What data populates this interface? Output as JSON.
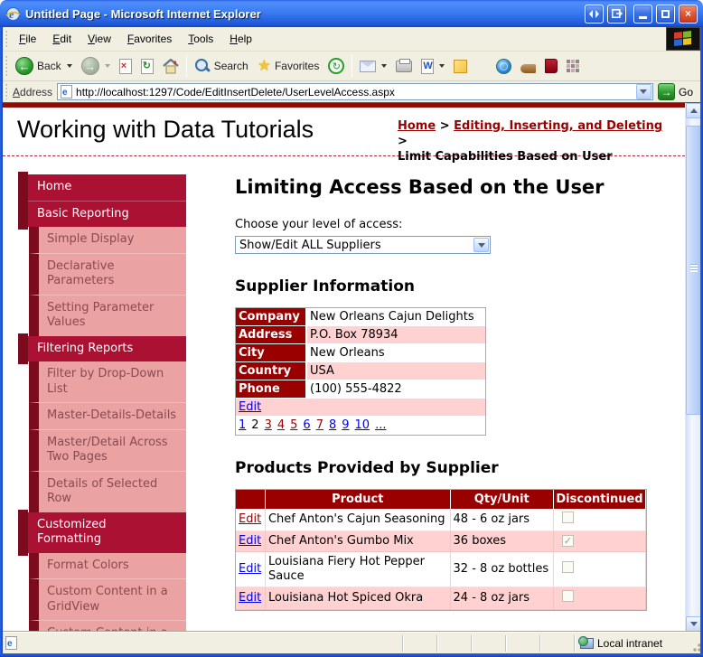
{
  "window": {
    "title": "Untitled Page - Microsoft Internet Explorer",
    "menu": [
      "File",
      "Edit",
      "View",
      "Favorites",
      "Tools",
      "Help"
    ],
    "toolbar": {
      "back_label": "Back",
      "search_label": "Search",
      "favorites_label": "Favorites"
    },
    "address": {
      "label": "Address",
      "value": "http://localhost:1297/Code/EditInsertDelete/UserLevelAccess.aspx",
      "go_label": "Go"
    },
    "status": {
      "zone_label": "Local intranet"
    }
  },
  "icons": {
    "close_glyph": "×",
    "back_glyph": "←",
    "forward_glyph": "→",
    "stop_glyph": "×",
    "refresh_glyph": "↻",
    "history_glyph": "↻",
    "favorites_glyph": "★",
    "go_glyph": "→",
    "check_glyph": "✓",
    "ie_glyph": "e"
  },
  "theme": {
    "maroon": "#990000",
    "category_red": "#AA1133",
    "rail_dark": "#7A0C1E",
    "sidebar_pink": "#EBA2A2",
    "row_pink": "#FFD1D1",
    "link_blue": "#0000EE",
    "link_visited": "#990000",
    "titlebar_blue": "#3b7cf2"
  },
  "page": {
    "site_title": "Working with Data Tutorials",
    "breadcrumb": {
      "links": [
        "Home",
        "Editing, Inserting, and Deleting"
      ],
      "separator": ">",
      "current": "Limit Capabilities Based on User"
    },
    "sidebar": [
      {
        "label": "Home",
        "type": "category"
      },
      {
        "label": "Basic Reporting",
        "type": "category"
      },
      {
        "label": "Simple Display",
        "type": "item"
      },
      {
        "label": "Declarative Parameters",
        "type": "item"
      },
      {
        "label": "Setting Parameter Values",
        "type": "item"
      },
      {
        "label": "Filtering Reports",
        "type": "category"
      },
      {
        "label": "Filter by Drop-Down List",
        "type": "item"
      },
      {
        "label": "Master-Details-Details",
        "type": "item"
      },
      {
        "label": "Master/Detail Across Two Pages",
        "type": "item"
      },
      {
        "label": "Details of Selected Row",
        "type": "item"
      },
      {
        "label": "Customized Formatting",
        "type": "category"
      },
      {
        "label": "Format Colors",
        "type": "item"
      },
      {
        "label": "Custom Content in a GridView",
        "type": "item"
      },
      {
        "label": "Custom Content in a DetailsView",
        "type": "item"
      }
    ],
    "main": {
      "heading": "Limiting Access Based on the User",
      "access_label": "Choose your level of access:",
      "access_value": "Show/Edit ALL Suppliers",
      "supplier_heading": "Supplier Information",
      "supplier": {
        "rows": [
          {
            "label": "Company",
            "value": "New Orleans Cajun Delights"
          },
          {
            "label": "Address",
            "value": "P.O. Box 78934"
          },
          {
            "label": "City",
            "value": "New Orleans"
          },
          {
            "label": "Country",
            "value": "USA"
          },
          {
            "label": "Phone",
            "value": "(100) 555-4822"
          }
        ],
        "edit_label": "Edit",
        "pager": [
          {
            "label": "1",
            "state": "link"
          },
          {
            "label": "2",
            "state": "current"
          },
          {
            "label": "3",
            "state": "visited"
          },
          {
            "label": "4",
            "state": "visited"
          },
          {
            "label": "5",
            "state": "visited"
          },
          {
            "label": "6",
            "state": "link"
          },
          {
            "label": "7",
            "state": "visited"
          },
          {
            "label": "8",
            "state": "link"
          },
          {
            "label": "9",
            "state": "link"
          },
          {
            "label": "10",
            "state": "link"
          },
          {
            "label": "...",
            "state": "link"
          }
        ]
      },
      "products_heading": "Products Provided by Supplier",
      "products": {
        "headers": [
          "",
          "Product",
          "Qty/Unit",
          "Discontinued"
        ],
        "edit_label": "Edit",
        "rows": [
          {
            "product": "Chef Anton's Cajun Seasoning",
            "qty": "48 - 6 oz jars",
            "discontinued": false,
            "edit_visited": true
          },
          {
            "product": "Chef Anton's Gumbo Mix",
            "qty": "36 boxes",
            "discontinued": true,
            "edit_visited": false
          },
          {
            "product": "Louisiana Fiery Hot Pepper Sauce",
            "qty": "32 - 8 oz bottles",
            "discontinued": false,
            "edit_visited": false
          },
          {
            "product": "Louisiana Hot Spiced Okra",
            "qty": "24 - 8 oz jars",
            "discontinued": false,
            "edit_visited": false
          }
        ]
      }
    }
  }
}
